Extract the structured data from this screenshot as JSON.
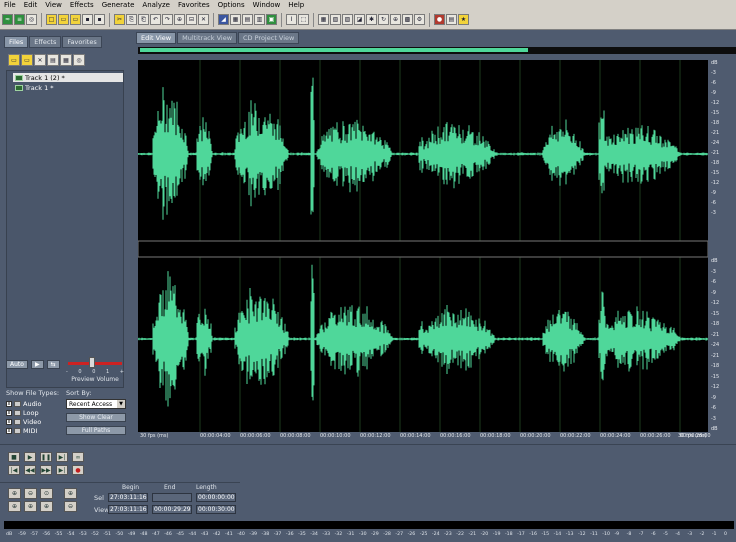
{
  "menu": [
    "File",
    "Edit",
    "View",
    "Effects",
    "Generate",
    "Analyze",
    "Favorites",
    "Options",
    "Window",
    "Help"
  ],
  "left_tabs": [
    "Files",
    "Effects",
    "Favorites"
  ],
  "files": [
    "Track 1 (2) *",
    "Track 1 *"
  ],
  "auto_label": "Auto",
  "preview_volume": {
    "label": "Preview Volume",
    "scale": [
      "-",
      "0",
      "0",
      "1",
      "+"
    ]
  },
  "show_file_types": {
    "label": "Show File Types:",
    "items": [
      {
        "label": "Audio",
        "checked": true
      },
      {
        "label": "Loop",
        "checked": true
      },
      {
        "label": "Video",
        "checked": true
      },
      {
        "label": "MIDI",
        "checked": true
      }
    ]
  },
  "sort_by": {
    "label": "Sort By:",
    "value": "Recent Access",
    "show_clear": "Show Clear",
    "full_paths": "Full Paths"
  },
  "main_tabs": [
    "Edit View",
    "Multitrack View",
    "CD Project View"
  ],
  "db_top": [
    "dB",
    "-3",
    "-6",
    "-9",
    "-12",
    "-15",
    "-18",
    "-21",
    "-24",
    "-21",
    "-18",
    "-15",
    "-12",
    "-9",
    "-6",
    "-3"
  ],
  "db_bot": [
    "dB",
    "-3",
    "-6",
    "-9",
    "-12",
    "-15",
    "-18",
    "-21",
    "-24",
    "-21",
    "-18",
    "-15",
    "-12",
    "-9",
    "-6",
    "-3",
    "dB"
  ],
  "time_ticks": [
    "30 fps (ms)",
    "00:00:04:00",
    "00:00:06:00",
    "00:00:08:00",
    "00:00:10:00",
    "00:00:12:00",
    "00:00:14:00",
    "00:00:16:00",
    "00:00:18:00",
    "00:00:20:00",
    "00:00:22:00",
    "00:00:24:00",
    "00:00:26:00",
    "00:00:28:00",
    "30 fps (ms)"
  ],
  "selection": {
    "begin_label": "Begin",
    "end_label": "End",
    "length_label": "Length",
    "sel_label": "Sel",
    "view_label": "View",
    "sel_begin": "27:03:11:16",
    "sel_end": "",
    "sel_length": "00:00:00:00",
    "view_begin": "27:03:11:16",
    "view_end": "00:00:29:29",
    "view_length": "00:00:30:00"
  },
  "meter_scale": [
    "dB",
    "-59",
    "-57",
    "-56",
    "-55",
    "-54",
    "-53",
    "-52",
    "-51",
    "-50",
    "-49",
    "-48",
    "-47",
    "-46",
    "-45",
    "-44",
    "-43",
    "-42",
    "-41",
    "-40",
    "-39",
    "-38",
    "-37",
    "-36",
    "-35",
    "-34",
    "-33",
    "-32",
    "-31",
    "-30",
    "-29",
    "-28",
    "-27",
    "-26",
    "-25",
    "-24",
    "-23",
    "-22",
    "-21",
    "-20",
    "-19",
    "-18",
    "-17",
    "-16",
    "-15",
    "-14",
    "-13",
    "-12",
    "-11",
    "-10",
    "-9",
    "-8",
    "-7",
    "-6",
    "-5",
    "-4",
    "-3",
    "-2",
    "-1",
    "0"
  ],
  "colors": {
    "waveform": "#4fd79a",
    "background": "#000000",
    "panel": "#4f5b6f",
    "grid": "#1b3a1b"
  }
}
